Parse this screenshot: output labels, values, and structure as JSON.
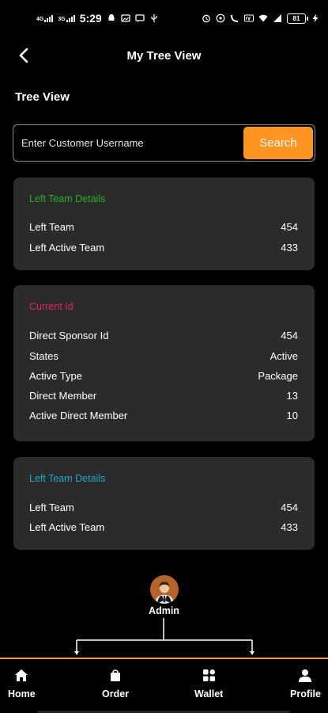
{
  "status_bar": {
    "net1_label": "4G",
    "net2_label": "3G",
    "time": "5:29",
    "battery": "81"
  },
  "header": {
    "title": "My Tree View",
    "back_icon": "chevron-left-icon"
  },
  "section_title": "Tree View",
  "search": {
    "placeholder": "Enter Customer Username",
    "value": "",
    "button_label": "Search",
    "button_color": "#ff9421"
  },
  "cards": [
    {
      "heading": "Left Team Details",
      "heading_color": "#22b022",
      "rows": [
        {
          "label": "Left Team",
          "value": "454"
        },
        {
          "label": "Left Active Team",
          "value": "433"
        }
      ]
    },
    {
      "heading": "Current Id",
      "heading_color": "#e0245e",
      "rows": [
        {
          "label": "Direct Sponsor Id",
          "value": "454"
        },
        {
          "label": "States",
          "value": "Active"
        },
        {
          "label": "Active Type",
          "value": "Package"
        },
        {
          "label": "Direct Member",
          "value": "13"
        },
        {
          "label": "Active Direct Member",
          "value": "10"
        }
      ]
    },
    {
      "heading": "Left Team Details",
      "heading_color": "#1ba7c8",
      "rows": [
        {
          "label": "Left Team",
          "value": "454"
        },
        {
          "label": "Left Active Team",
          "value": "433"
        }
      ]
    }
  ],
  "tree": {
    "root_label": "Admin",
    "avatar_icon": "user-avatar-icon"
  },
  "bottom_nav": {
    "accent_color": "#ff9421",
    "items": [
      {
        "label": "Home",
        "icon": "home-icon"
      },
      {
        "label": "Order",
        "icon": "shopping-bag-icon"
      },
      {
        "label": "Wallet",
        "icon": "wallet-grid-icon"
      },
      {
        "label": "Profile",
        "icon": "person-icon"
      }
    ]
  }
}
